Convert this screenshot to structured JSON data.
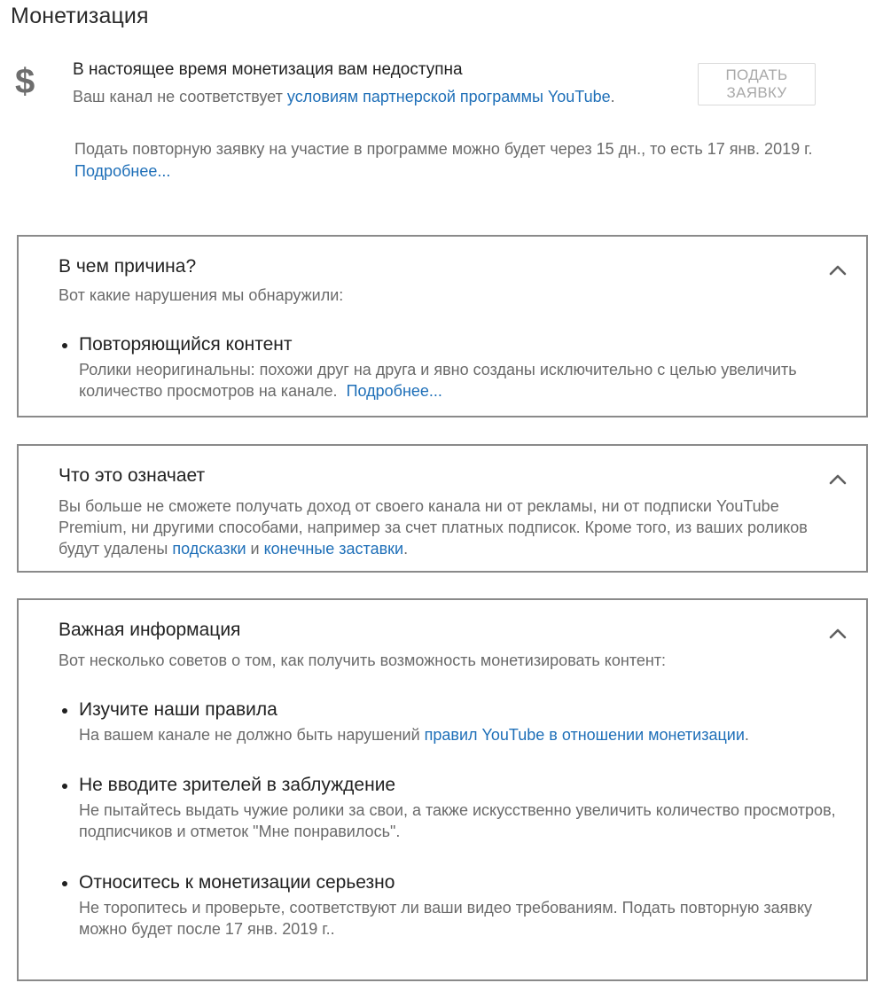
{
  "page": {
    "title": "Монетизация"
  },
  "status": {
    "icon": "dollar-icon",
    "icon_glyph": "$",
    "title": "В настоящее время монетизация вам недоступна",
    "desc_prefix": "Ваш канал не соответствует ",
    "desc_link": "условиям партнерской программы YouTube",
    "desc_suffix": ".",
    "apply_button": "ПОДАТЬ ЗАЯВКУ",
    "reapply_text": "Подать повторную заявку на участие в программе можно будет через 15 дн., то есть 17 янв. 2019 г.",
    "reapply_link": "Подробнее..."
  },
  "cards": {
    "reason": {
      "title": "В чем причина?",
      "subtitle": "Вот какие нарушения мы обнаружили:",
      "items": [
        {
          "heading": "Повторяющийся контент",
          "body": "Ролики неоригинальны: похожи друг на друга и явно созданы исключительно с целью увеличить количество просмотров на канале.",
          "link": "Подробнее..."
        }
      ]
    },
    "meaning": {
      "title": "Что это означает",
      "body_prefix": "Вы больше не сможете получать доход от своего канала ни от рекламы, ни от подписки YouTube Premium, ни другими способами, например за счет платных подписок. Кроме того, из ваших роликов будут удалены ",
      "link1": "подсказки",
      "middle": " и ",
      "link2": "конечные заставки",
      "suffix": "."
    },
    "important": {
      "title": "Важная информация",
      "subtitle": "Вот несколько советов о том, как получить возможность монетизировать контент:",
      "items": [
        {
          "heading": "Изучите наши правила",
          "body_prefix": "На вашем канале не должно быть нарушений ",
          "link": "правил YouTube в отношении монетизации",
          "body_suffix": "."
        },
        {
          "heading": "Не вводите зрителей в заблуждение",
          "body": "Не пытайтесь выдать чужие ролики за свои, а также искусственно увеличить количество просмотров, подписчиков и отметок \"Мне понравилось\"."
        },
        {
          "heading": "Относитесь к монетизации серьезно",
          "body": "Не торопитесь и проверьте, соответствуют ли ваши видео требованиям. Подать повторную заявку можно будет после 17 янв. 2019 г.."
        }
      ]
    },
    "chevron_icon": "chevron-up-icon"
  },
  "colors": {
    "link": "#1e6fb8",
    "text_primary": "#212121",
    "text_secondary": "#6a6a6a",
    "card_border": "#8a8a8a",
    "button_text_disabled": "#a9a9a9"
  }
}
